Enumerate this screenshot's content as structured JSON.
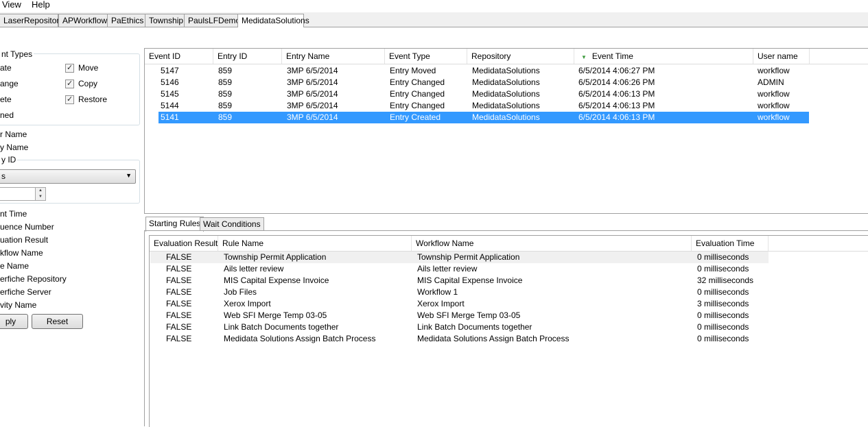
{
  "menu": [
    "View",
    "Help"
  ],
  "repo_tabs": [
    "LaserRepository",
    "APWorkflow",
    "PaEthics",
    "Township",
    "PaulsLFDemo",
    "MedidataSolutions"
  ],
  "filters": {
    "event_types_title": "nt Types",
    "left_items": [
      "ate",
      "ange",
      "ete",
      "ned"
    ],
    "checkboxes": [
      {
        "label": "Move",
        "checked": true
      },
      {
        "label": "Copy",
        "checked": true
      },
      {
        "label": "Restore",
        "checked": true
      }
    ],
    "fields_a": [
      "r Name",
      "y Name"
    ],
    "entry_id_title": "y ID",
    "select_value": "s",
    "fields_b": [
      "nt Time",
      "uence Number",
      "uation Result",
      "kflow Name",
      "e Name",
      "erfiche Repository",
      "erfiche Server",
      "vity Name"
    ],
    "apply_label": "ply",
    "reset_label": "Reset"
  },
  "events": {
    "headers": [
      "Event ID",
      "Entry ID",
      "Entry Name",
      "Event Type",
      "Repository",
      "Event Time",
      "User name"
    ],
    "sorted_column": "Event Time",
    "rows": [
      [
        "5147",
        "859",
        "3MP 6/5/2014",
        "Entry Moved",
        "MedidataSolutions",
        "6/5/2014 4:06:27 PM",
        "workflow"
      ],
      [
        "5146",
        "859",
        "3MP 6/5/2014",
        "Entry Changed",
        "MedidataSolutions",
        "6/5/2014 4:06:26 PM",
        "ADMIN"
      ],
      [
        "5145",
        "859",
        "3MP 6/5/2014",
        "Entry Changed",
        "MedidataSolutions",
        "6/5/2014 4:06:13 PM",
        "workflow"
      ],
      [
        "5144",
        "859",
        "3MP 6/5/2014",
        "Entry Changed",
        "MedidataSolutions",
        "6/5/2014 4:06:13 PM",
        "workflow"
      ],
      [
        "5141",
        "859",
        "3MP 6/5/2014",
        "Entry Created",
        "MedidataSolutions",
        "6/5/2014 4:06:13 PM",
        "workflow"
      ]
    ],
    "selected_row": 4
  },
  "detail_tabs": [
    "Starting Rules",
    "Wait Conditions"
  ],
  "rules": {
    "headers": [
      "Evaluation Result",
      "Rule Name",
      "Workflow Name",
      "Evaluation Time"
    ],
    "rows": [
      [
        "FALSE",
        "Township Permit Application",
        "Township Permit Application",
        "0 milliseconds"
      ],
      [
        "FALSE",
        "Ails letter review",
        "Ails letter review",
        "0 milliseconds"
      ],
      [
        "FALSE",
        "MIS Capital Expense Invoice",
        "MIS Capital Expense Invoice",
        "32 milliseconds"
      ],
      [
        "FALSE",
        "Job Files",
        "Workflow 1",
        "0 milliseconds"
      ],
      [
        "FALSE",
        "Xerox Import",
        "Xerox Import",
        "3 milliseconds"
      ],
      [
        "FALSE",
        "Web SFI Merge Temp 03-05",
        "Web SFI Merge Temp 03-05",
        "0 milliseconds"
      ],
      [
        "FALSE",
        "Link Batch Documents together",
        "Link Batch Documents together",
        "0 milliseconds"
      ],
      [
        "FALSE",
        "Medidata Solutions Assign Batch Process",
        "Medidata Solutions Assign Batch Process",
        "0 milliseconds"
      ]
    ],
    "hover_row": 0
  },
  "colors": {
    "selection": "#3399ff",
    "sort_arrow": "#3c9a3c"
  }
}
